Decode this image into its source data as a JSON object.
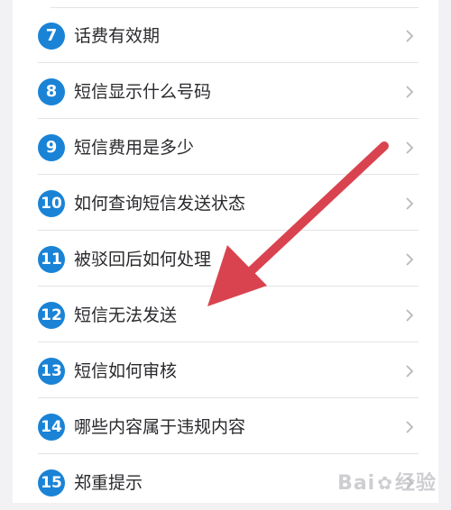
{
  "faq_list": [
    {
      "number": "7",
      "label": "话费有效期"
    },
    {
      "number": "8",
      "label": "短信显示什么号码"
    },
    {
      "number": "9",
      "label": "短信费用是多少"
    },
    {
      "number": "10",
      "label": "如何查询短信发送状态"
    },
    {
      "number": "11",
      "label": "被驳回后如何处理"
    },
    {
      "number": "12",
      "label": "短信无法发送"
    },
    {
      "number": "13",
      "label": "短信如何审核"
    },
    {
      "number": "14",
      "label": "哪些内容属于违规内容"
    },
    {
      "number": "15",
      "label": "郑重提示"
    }
  ],
  "watermark": {
    "text": "Bai",
    "suffix": "经验"
  },
  "colors": {
    "badge": "#1a83d6",
    "arrow": "#d9434f",
    "chevron": "#b8b8bd"
  },
  "icons": {
    "row_chevron": "chevron-right-icon",
    "annotation": "red-arrow-icon"
  }
}
